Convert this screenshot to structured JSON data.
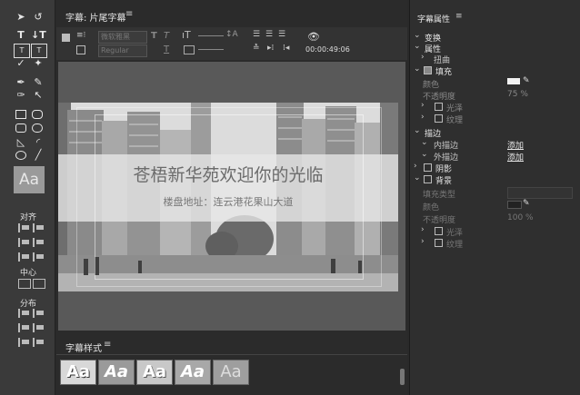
{
  "center": {
    "title": "字幕: 片尾字幕",
    "menu_icon": "hamburger-icon",
    "font_family": "微软雅黑",
    "font_style": "Regular",
    "timecode": "00:00:49:06",
    "main_caption": "苍梧新华苑欢迎你的光临",
    "sub_caption": "楼盘地址：连云港花果山大道"
  },
  "tools": {
    "preview_label": "Aa",
    "align_label": "对齐",
    "center_label": "中心",
    "distribute_label": "分布"
  },
  "styles": {
    "title": "字幕样式",
    "swatches": [
      "Aa",
      "Aa",
      "Aa",
      "Aa",
      "Aa"
    ]
  },
  "props": {
    "title": "字幕属性",
    "transform": "变换",
    "properties": "属性",
    "distort": "扭曲",
    "fill": "填充",
    "color_label": "颜色",
    "opacity_label": "不透明度",
    "fill_opacity": "75 %",
    "sheen": "光泽",
    "texture": "纹理",
    "strokes": "描边",
    "inner_stroke": "内描边",
    "outer_stroke": "外描边",
    "add": "添加",
    "shadow": "阴影",
    "background": "背景",
    "fill_type": "填充类型",
    "bg_color_label": "颜色",
    "bg_opacity_label": "不透明度",
    "bg_opacity": "100 %",
    "bg_sheen": "光泽",
    "bg_texture": "纹理"
  },
  "colors": {
    "accent": "#e8e8e8",
    "panel": "#2f2f2f"
  }
}
